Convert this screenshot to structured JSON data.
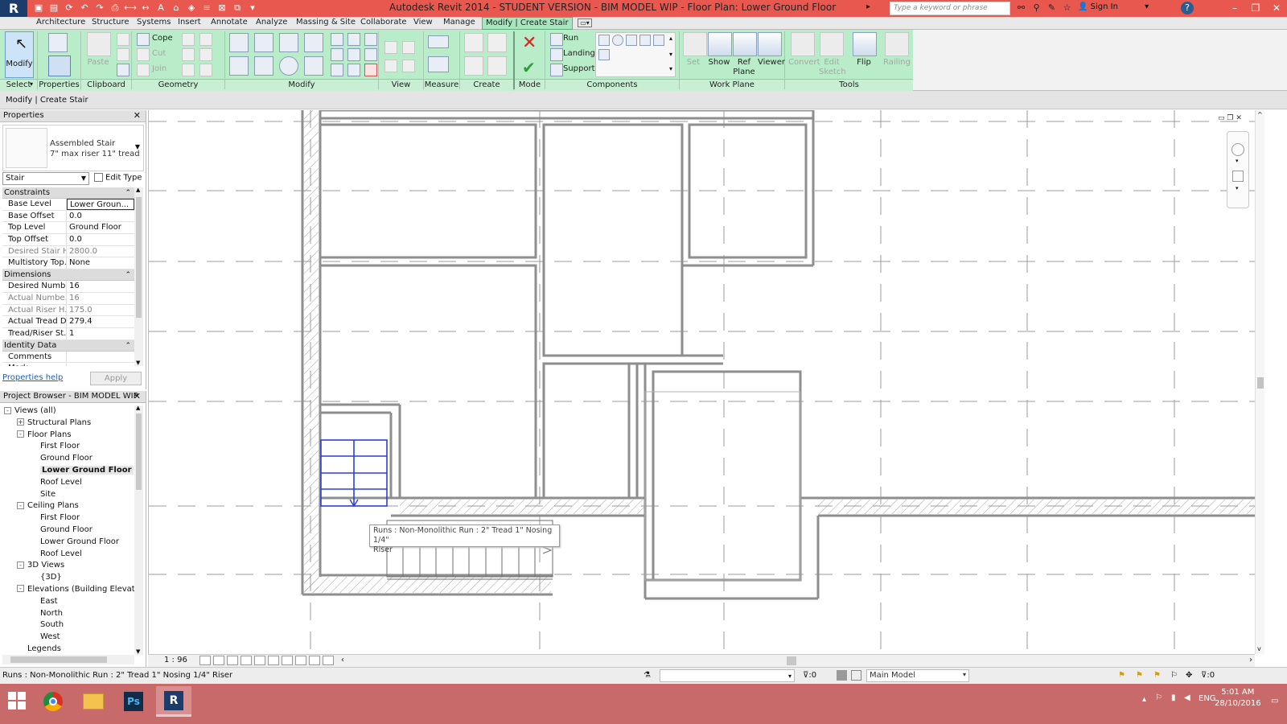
{
  "titlebar": {
    "title": "Autodesk Revit 2014 -  STUDENT VERSION -     BIM MODEL WIP - Floor Plan: Lower Ground Floor",
    "search_placeholder": "Type a keyword or phrase",
    "sign_in": "Sign In"
  },
  "tabs": [
    "Architecture",
    "Structure",
    "Systems",
    "Insert",
    "Annotate",
    "Analyze",
    "Massing & Site",
    "Collaborate",
    "View",
    "Manage",
    "Modify | Create Stair"
  ],
  "active_tab": "Modify | Create Stair",
  "ribbon": {
    "modify": "Modify",
    "select": "Select",
    "properties": "Properties",
    "clipboard_paste": "Paste",
    "cope": "Cope",
    "cut": "Cut",
    "join": "Join",
    "run": "Run",
    "landing": "Landing",
    "support": "Support",
    "set": "Set",
    "show": "Show",
    "ref_plane": "Ref\nPlane",
    "viewer": "Viewer",
    "convert": "Convert",
    "edit_sketch": "Edit\nSketch",
    "flip": "Flip",
    "railing": "Railing",
    "panels": {
      "select": "Select",
      "properties": "Properties",
      "clipboard": "Clipboard",
      "geometry": "Geometry",
      "modify": "Modify",
      "view": "View",
      "measure": "Measure",
      "create": "Create",
      "mode": "Mode",
      "components": "Components",
      "work_plane": "Work Plane",
      "tools": "Tools"
    }
  },
  "context_label": "Modify | Create Stair",
  "properties": {
    "title": "Properties",
    "type_name": "Assembled Stair",
    "type_sub": "7\" max riser 11\" tread",
    "category": "Stair",
    "edit_type": "Edit Type",
    "groups": [
      {
        "name": "Constraints",
        "rows": [
          {
            "k": "Base Level",
            "v": "Lower Groun...",
            "edit": true
          },
          {
            "k": "Base Offset",
            "v": "0.0"
          },
          {
            "k": "Top Level",
            "v": "Ground  Floor"
          },
          {
            "k": "Top Offset",
            "v": "0.0"
          },
          {
            "k": "Desired Stair H...",
            "v": "2800.0",
            "ro": true
          },
          {
            "k": "Multistory Top...",
            "v": "None"
          }
        ]
      },
      {
        "name": "Dimensions",
        "rows": [
          {
            "k": "Desired Numb...",
            "v": "16"
          },
          {
            "k": "Actual Numbe...",
            "v": "16",
            "ro": true
          },
          {
            "k": "Actual Riser H...",
            "v": "175.0",
            "ro": true
          },
          {
            "k": "Actual Tread D...",
            "v": "279.4"
          },
          {
            "k": "Tread/Riser St...",
            "v": "1"
          }
        ]
      },
      {
        "name": "Identity Data",
        "rows": [
          {
            "k": "Comments",
            "v": ""
          },
          {
            "k": "Mark",
            "v": ""
          }
        ]
      }
    ],
    "help": "Properties help",
    "apply": "Apply"
  },
  "browser": {
    "title": "Project Browser - BIM MODEL WIP",
    "nodes": [
      {
        "label": "Views (all)",
        "depth": 0,
        "exp": "-"
      },
      {
        "label": "Structural Plans",
        "depth": 1,
        "exp": "+"
      },
      {
        "label": "Floor Plans",
        "depth": 1,
        "exp": "-"
      },
      {
        "label": "First Floor",
        "depth": 2
      },
      {
        "label": "Ground  Floor",
        "depth": 2
      },
      {
        "label": "Lower Ground Floor",
        "depth": 2,
        "selected": true
      },
      {
        "label": "Roof Level",
        "depth": 2
      },
      {
        "label": "Site",
        "depth": 2
      },
      {
        "label": "Ceiling Plans",
        "depth": 1,
        "exp": "-"
      },
      {
        "label": "First Floor",
        "depth": 2
      },
      {
        "label": "Ground  Floor",
        "depth": 2
      },
      {
        "label": "Lower Ground Floor",
        "depth": 2
      },
      {
        "label": "Roof Level",
        "depth": 2
      },
      {
        "label": "3D Views",
        "depth": 1,
        "exp": "-"
      },
      {
        "label": "{3D}",
        "depth": 2
      },
      {
        "label": "Elevations (Building Elevation)",
        "depth": 1,
        "exp": "-"
      },
      {
        "label": "East",
        "depth": 2
      },
      {
        "label": "North",
        "depth": 2
      },
      {
        "label": "South",
        "depth": 2
      },
      {
        "label": "West",
        "depth": 2
      },
      {
        "label": "Legends",
        "depth": 1
      }
    ]
  },
  "canvas": {
    "tooltip_line1": "Runs : Non-Monolithic Run : 2\" Tread 1\" Nosing 1/4\"",
    "tooltip_line2": "Riser"
  },
  "viewbar": {
    "scale": "1 : 96"
  },
  "statusbar": {
    "text": "Runs : Non-Monolithic Run : 2\" Tread 1\" Nosing 1/4\" Riser",
    "zero": ":0",
    "model": "Main Model",
    "filter": ":0"
  },
  "taskbar": {
    "lang": "ENG",
    "time": "5:01 AM",
    "date": "28/10/2016"
  },
  "colors": {
    "title_bg": "#e8584f",
    "ribbon_green": "#b9ecc8",
    "taskbar": "#c86a6a",
    "stair_blue": "#2b3fd6"
  }
}
